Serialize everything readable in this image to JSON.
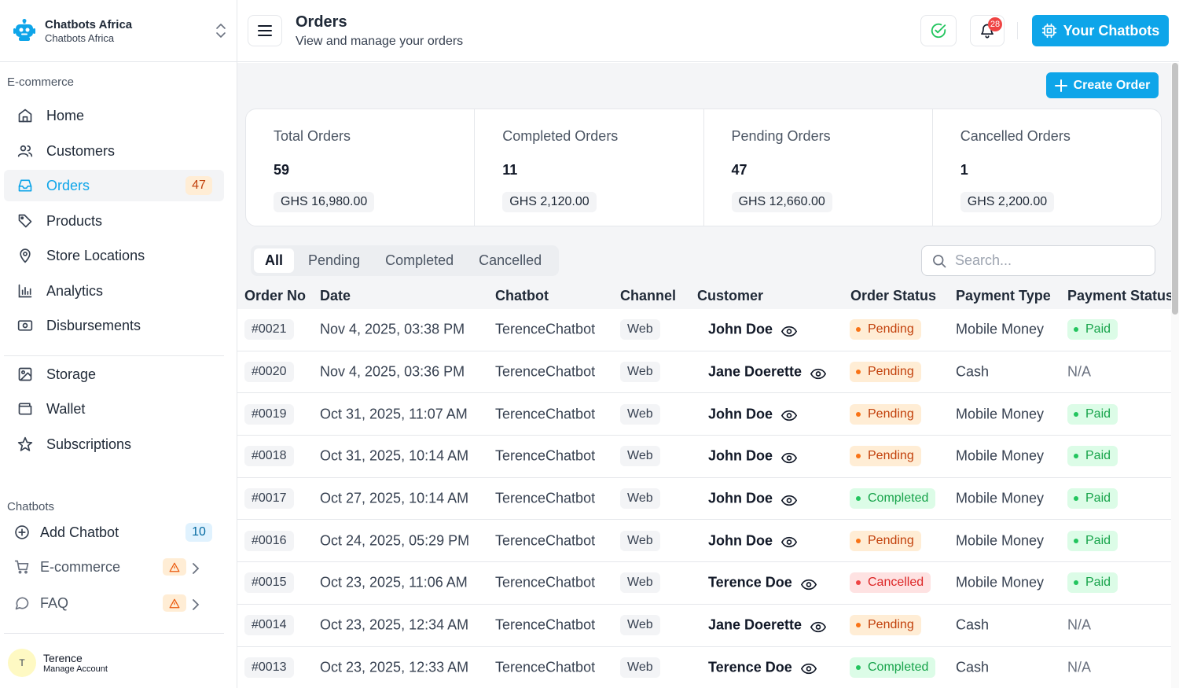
{
  "brand": {
    "name": "Chatbots Africa",
    "sub": "Chatbots Africa"
  },
  "sidebar": {
    "section1": "E-commerce",
    "items": [
      {
        "label": "Home",
        "icon": "home-icon"
      },
      {
        "label": "Customers",
        "icon": "users-icon"
      },
      {
        "label": "Orders",
        "icon": "inbox-icon",
        "badge": "47"
      },
      {
        "label": "Products",
        "icon": "tag-icon"
      },
      {
        "label": "Store Locations",
        "icon": "map-pin-icon"
      },
      {
        "label": "Analytics",
        "icon": "bar-chart-icon"
      },
      {
        "label": "Disbursements",
        "icon": "banknote-icon"
      }
    ],
    "items2": [
      {
        "label": "Storage",
        "icon": "image-icon"
      },
      {
        "label": "Wallet",
        "icon": "wallet-icon"
      },
      {
        "label": "Subscriptions",
        "icon": "star-icon"
      }
    ],
    "section2": "Chatbots",
    "chatbots": {
      "add": {
        "label": "Add Chatbot",
        "badge": "10"
      },
      "ecommerce": {
        "label": "E-commerce"
      },
      "faq": {
        "label": "FAQ"
      }
    },
    "account": {
      "initial": "T",
      "name": "Terence",
      "sub": "Manage Account"
    }
  },
  "header": {
    "title": "Orders",
    "subtitle": "View and manage your orders",
    "notif_count": "28",
    "cta": "Your Chatbots"
  },
  "main": {
    "create_label": "Create Order",
    "stats": [
      {
        "label": "Total Orders",
        "value": "59",
        "amount": "GHS 16,980.00"
      },
      {
        "label": "Completed Orders",
        "value": "11",
        "amount": "GHS 2,120.00"
      },
      {
        "label": "Pending Orders",
        "value": "47",
        "amount": "GHS 12,660.00"
      },
      {
        "label": "Cancelled Orders",
        "value": "1",
        "amount": "GHS 2,200.00"
      }
    ],
    "tabs": [
      "All",
      "Pending",
      "Completed",
      "Cancelled"
    ],
    "search_placeholder": "Search..."
  },
  "table": {
    "columns": [
      "Order No",
      "Date",
      "Chatbot",
      "Channel",
      "Customer",
      "Order Status",
      "Payment Type",
      "Payment Status"
    ],
    "rows": [
      {
        "no": "#0021",
        "date": "Nov 4, 2025, 03:38 PM",
        "chatbot": "TerenceChatbot",
        "channel": "Web",
        "customer": "John Doe",
        "status": "Pending",
        "ptype": "Mobile Money",
        "pstatus": "Paid"
      },
      {
        "no": "#0020",
        "date": "Nov 4, 2025, 03:36 PM",
        "chatbot": "TerenceChatbot",
        "channel": "Web",
        "customer": "Jane Doerette",
        "status": "Pending",
        "ptype": "Cash",
        "pstatus": "N/A"
      },
      {
        "no": "#0019",
        "date": "Oct 31, 2025, 11:07 AM",
        "chatbot": "TerenceChatbot",
        "channel": "Web",
        "customer": "John Doe",
        "status": "Pending",
        "ptype": "Mobile Money",
        "pstatus": "Paid"
      },
      {
        "no": "#0018",
        "date": "Oct 31, 2025, 10:14 AM",
        "chatbot": "TerenceChatbot",
        "channel": "Web",
        "customer": "John Doe",
        "status": "Pending",
        "ptype": "Mobile Money",
        "pstatus": "Paid"
      },
      {
        "no": "#0017",
        "date": "Oct 27, 2025, 10:14 AM",
        "chatbot": "TerenceChatbot",
        "channel": "Web",
        "customer": "John Doe",
        "status": "Completed",
        "ptype": "Mobile Money",
        "pstatus": "Paid"
      },
      {
        "no": "#0016",
        "date": "Oct 24, 2025, 05:29 PM",
        "chatbot": "TerenceChatbot",
        "channel": "Web",
        "customer": "John Doe",
        "status": "Pending",
        "ptype": "Mobile Money",
        "pstatus": "Paid"
      },
      {
        "no": "#0015",
        "date": "Oct 23, 2025, 11:06 AM",
        "chatbot": "TerenceChatbot",
        "channel": "Web",
        "customer": "Terence Doe",
        "status": "Cancelled",
        "ptype": "Mobile Money",
        "pstatus": "Paid"
      },
      {
        "no": "#0014",
        "date": "Oct 23, 2025, 12:34 AM",
        "chatbot": "TerenceChatbot",
        "channel": "Web",
        "customer": "Jane Doerette",
        "status": "Pending",
        "ptype": "Cash",
        "pstatus": "N/A"
      },
      {
        "no": "#0013",
        "date": "Oct 23, 2025, 12:33 AM",
        "chatbot": "TerenceChatbot",
        "channel": "Web",
        "customer": "Terence Doe",
        "status": "Completed",
        "ptype": "Cash",
        "pstatus": "N/A"
      }
    ]
  },
  "colors": {
    "accent": "#0ea5e9",
    "pending": "#f97316",
    "completed": "#22c55e",
    "cancelled": "#ef4444"
  }
}
